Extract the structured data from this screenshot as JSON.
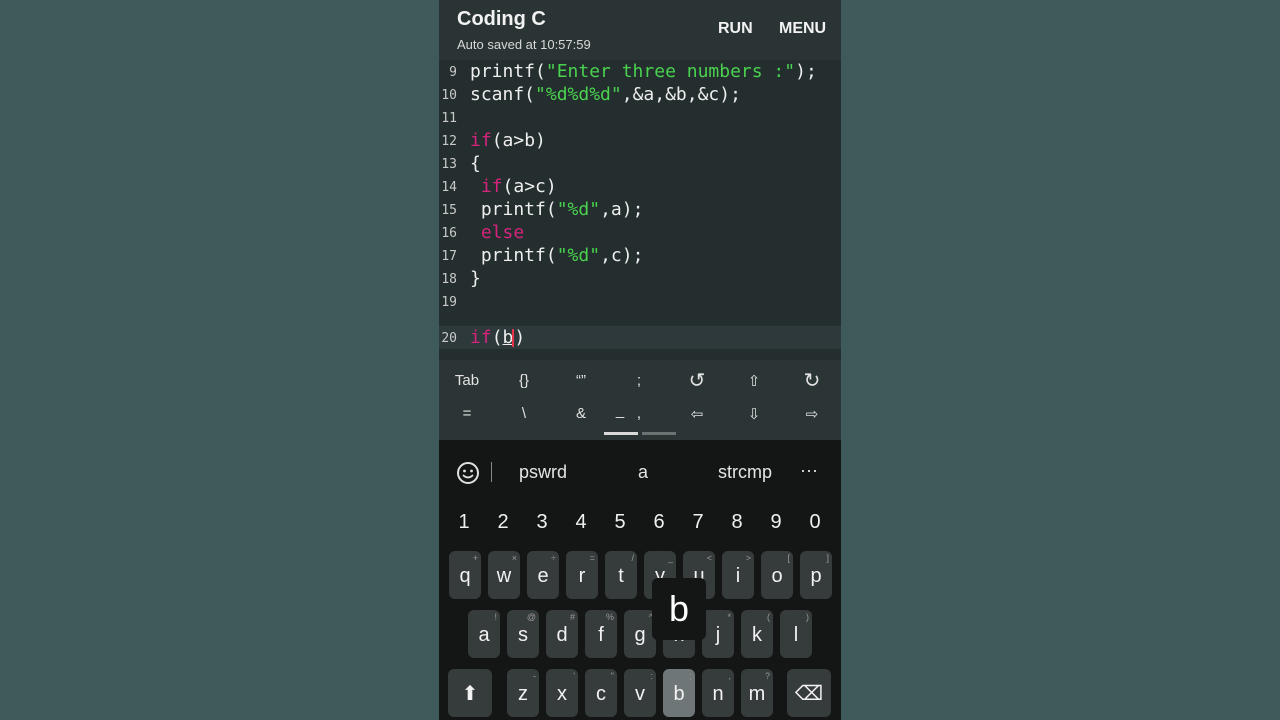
{
  "app": {
    "title": "Coding C",
    "subtitle": "Auto saved at 10:57:59",
    "run_label": "RUN",
    "menu_label": "MENU"
  },
  "editor": {
    "lines": [
      {
        "num": "9",
        "code": "printf(\"Enter three numbers :\");"
      },
      {
        "num": "10",
        "code": "scanf(\"%d%d%d\",&a,&b,&c);"
      },
      {
        "num": "11",
        "code": ""
      },
      {
        "num": "12",
        "code": "if(a>b)"
      },
      {
        "num": "13",
        "code": "{"
      },
      {
        "num": "14",
        "code": " if(a>c)"
      },
      {
        "num": "15",
        "code": " printf(\"%d\",a);"
      },
      {
        "num": "16",
        "code": " else"
      },
      {
        "num": "17",
        "code": " printf(\"%d\",c);"
      },
      {
        "num": "18",
        "code": "}"
      },
      {
        "num": "19",
        "code": ""
      },
      {
        "num": "20",
        "code": "if(b)"
      }
    ]
  },
  "extra_keys": {
    "row1": [
      "Tab",
      "{}",
      "“”",
      ";",
      "↺",
      "⇧",
      "↻"
    ],
    "row2": [
      "=",
      "\\",
      "&",
      "_",
      ",",
      "⇦",
      "⇩",
      "⇨"
    ]
  },
  "keyboard": {
    "suggestions": [
      "pswrd",
      "a",
      "strcmp",
      "···"
    ],
    "numbers": [
      "1",
      "2",
      "3",
      "4",
      "5",
      "6",
      "7",
      "8",
      "9",
      "0"
    ],
    "row1": [
      {
        "k": "q",
        "h": "+"
      },
      {
        "k": "w",
        "h": "×"
      },
      {
        "k": "e",
        "h": "÷"
      },
      {
        "k": "r",
        "h": "="
      },
      {
        "k": "t",
        "h": "/"
      },
      {
        "k": "y",
        "h": "_"
      },
      {
        "k": "u",
        "h": "<"
      },
      {
        "k": "i",
        "h": ">"
      },
      {
        "k": "o",
        "h": "["
      },
      {
        "k": "p",
        "h": "]"
      }
    ],
    "row2": [
      {
        "k": "a",
        "h": "!"
      },
      {
        "k": "s",
        "h": "@"
      },
      {
        "k": "d",
        "h": "#"
      },
      {
        "k": "f",
        "h": "%"
      },
      {
        "k": "g",
        "h": "^"
      },
      {
        "k": "h",
        "h": "&"
      },
      {
        "k": "j",
        "h": "*"
      },
      {
        "k": "k",
        "h": "("
      },
      {
        "k": "l",
        "h": ")"
      }
    ],
    "row3": [
      {
        "k": "z",
        "h": "-"
      },
      {
        "k": "x",
        "h": "'"
      },
      {
        "k": "c",
        "h": "\""
      },
      {
        "k": "v",
        "h": ":"
      },
      {
        "k": "b",
        "h": ";"
      },
      {
        "k": "n",
        "h": ","
      },
      {
        "k": "m",
        "h": "?"
      }
    ],
    "popup_letter": "b",
    "shift_icon": "⬆",
    "delete_icon": "⌫"
  }
}
